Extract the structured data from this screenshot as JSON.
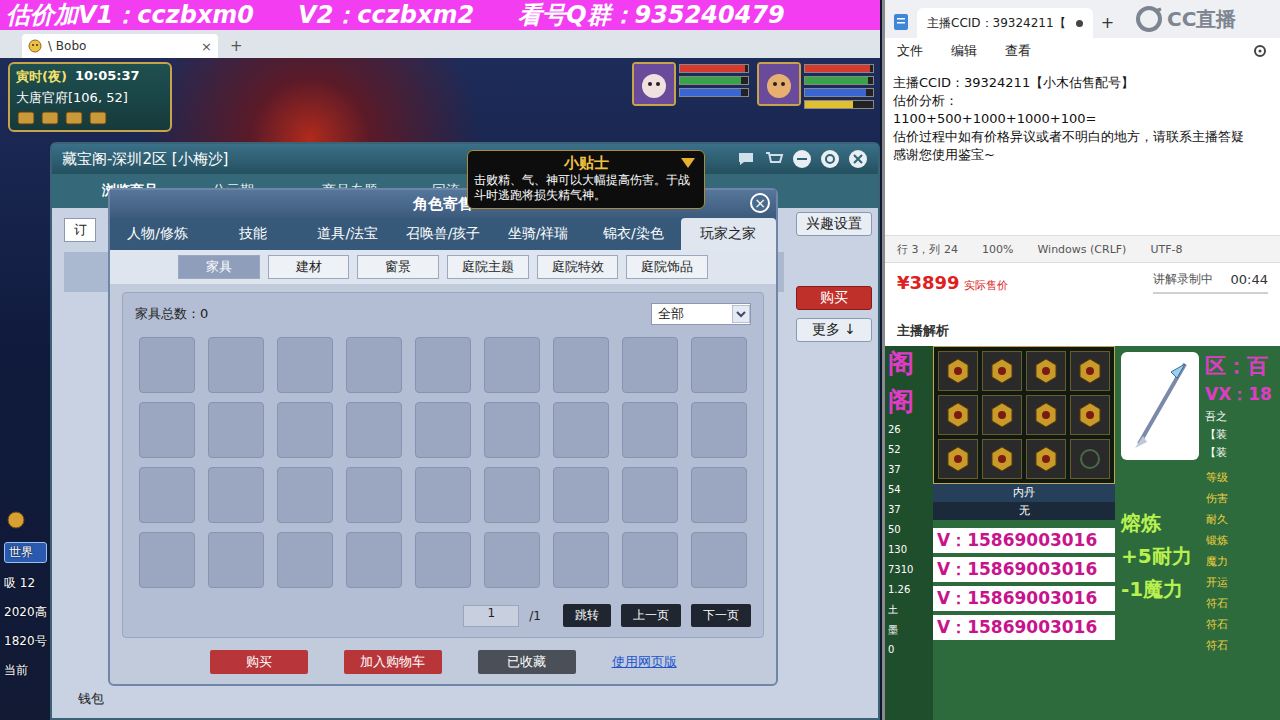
{
  "banner": {
    "items": [
      "估价加V1：cczbxm0",
      "V2：cczbxm2",
      "看号Q群：935240479"
    ]
  },
  "browser": {
    "tab": "\\ Bobo",
    "close": "×",
    "new_tab": "+"
  },
  "hud": {
    "period": "寅时(夜)",
    "time": "10:05:37",
    "location": "大唐官府[106, 52]"
  },
  "portraits": [
    {
      "bars": [
        {
          "level": 0.95,
          "color": "#d43a2f"
        },
        {
          "level": 0.9,
          "color": "#3aa34a"
        },
        {
          "level": 0.9,
          "color": "#3a66d4"
        }
      ]
    },
    {
      "bars": [
        {
          "level": 0.95,
          "color": "#d43a2f"
        },
        {
          "level": 0.92,
          "color": "#3aa34a"
        },
        {
          "level": 0.9,
          "color": "#3a66d4"
        },
        {
          "level": 0.7,
          "color": "#e0c030"
        }
      ]
    }
  ],
  "side": {
    "items": [
      "世界",
      "吸 12",
      "2020高",
      "1820号",
      "当前"
    ]
  },
  "cbg": {
    "title": "藏宝阁-深圳2区 [小梅沙]",
    "tabs": [
      {
        "label": "浏览商品",
        "selected": true
      },
      {
        "label": "公示期",
        "selected": false
      },
      {
        "label": "商品专题",
        "selected": false
      },
      {
        "label": "回流",
        "selected": false
      }
    ],
    "order_stub": "订",
    "side_buttons": [
      {
        "label": "兴趣设置",
        "kind": "plain"
      },
      {
        "label": "购买",
        "kind": "primary"
      },
      {
        "label": "更多 ↓",
        "kind": "plain"
      }
    ],
    "wallet": "钱包"
  },
  "dialog": {
    "title": "角色寄售",
    "close": "×",
    "tabs": [
      {
        "label": "人物/修炼",
        "selected": false
      },
      {
        "label": "技能",
        "selected": false
      },
      {
        "label": "道具/法宝",
        "selected": false
      },
      {
        "label": "召唤兽/孩子",
        "selected": false
      },
      {
        "label": "坐骑/祥瑞",
        "selected": false
      },
      {
        "label": "锦衣/染色",
        "selected": false
      },
      {
        "label": "玩家之家",
        "selected": true
      }
    ],
    "subtabs": [
      {
        "label": "家具",
        "selected": true
      },
      {
        "label": "建材",
        "selected": false
      },
      {
        "label": "窗景",
        "selected": false
      },
      {
        "label": "庭院主题",
        "selected": false
      },
      {
        "label": "庭院特效",
        "selected": false
      },
      {
        "label": "庭院饰品",
        "selected": false
      }
    ],
    "count_label": "家具总数：",
    "count": "0",
    "filter": "全部",
    "slots": [
      {
        "filled": false
      },
      {
        "filled": false
      },
      {
        "filled": false
      },
      {
        "filled": false
      },
      {
        "filled": false
      },
      {
        "filled": false
      },
      {
        "filled": false
      },
      {
        "filled": false
      },
      {
        "filled": false
      },
      {
        "filled": false
      },
      {
        "filled": false
      },
      {
        "filled": false
      },
      {
        "filled": false
      },
      {
        "filled": false
      },
      {
        "filled": false
      },
      {
        "filled": false
      },
      {
        "filled": false
      },
      {
        "filled": false
      },
      {
        "filled": false
      },
      {
        "filled": false
      },
      {
        "filled": false
      },
      {
        "filled": false
      },
      {
        "filled": false
      },
      {
        "filled": false
      },
      {
        "filled": false
      },
      {
        "filled": false
      },
      {
        "filled": false
      },
      {
        "filled": false
      },
      {
        "filled": false
      },
      {
        "filled": false
      },
      {
        "filled": false
      },
      {
        "filled": false
      },
      {
        "filled": false
      },
      {
        "filled": false
      },
      {
        "filled": false
      },
      {
        "filled": false
      }
    ],
    "pager": {
      "page": "1",
      "total": "/1"
    },
    "pager_buttons": [
      "跳转",
      "上一页",
      "下一页"
    ],
    "actions": [
      {
        "label": "购买",
        "kind": "primary"
      },
      {
        "label": "加入购物车",
        "kind": "primary"
      },
      {
        "label": "已收藏",
        "kind": "muted"
      }
    ],
    "web_link": "使用网页版"
  },
  "tip": {
    "title": "小贴士",
    "text": "击败精、气、神可以大幅提高伤害。于战斗时逃跑将损失精气神。"
  },
  "notepad": {
    "tab": "主播CCID：39324211【",
    "modified": true,
    "new_tab": "+",
    "menu": [
      "文件",
      "编辑",
      "查看"
    ],
    "lines": [
      "主播CCID：39324211【小木估售配号】",
      "估价分析：",
      "1100+500+1000+1000+100=",
      "估价过程中如有价格异议或者不明白的地方，请联系主播答疑",
      "感谢您使用鉴宝~"
    ],
    "status": [
      "行 3，列 24",
      "100%",
      "Windows (CRLF)",
      "UTF-8"
    ]
  },
  "logo": {
    "text": "CC直播"
  },
  "price": {
    "amount": "¥3899",
    "label": "实际售价",
    "recording": "讲解录制中",
    "timer": "00:44",
    "analysis": "主播解析"
  },
  "shot": {
    "marks": [
      "阁",
      "阁"
    ],
    "level": "26",
    "stats": [
      "52",
      "37",
      "54",
      "37",
      "50",
      "130",
      "7310",
      "1.26",
      "土",
      "墨",
      "0"
    ],
    "slots": [
      {
        "filled": true
      },
      {
        "filled": true
      },
      {
        "filled": true
      },
      {
        "filled": true
      },
      {
        "filled": true
      },
      {
        "filled": true
      },
      {
        "filled": true
      },
      {
        "filled": true
      },
      {
        "filled": true
      },
      {
        "filled": true
      },
      {
        "filled": true
      },
      {
        "filled": false
      }
    ],
    "neidan_label": "内丹",
    "neidan": "无",
    "contacts": [
      "V：15869003016",
      "V：15869003016",
      "V：15869003016",
      "V：15869003016"
    ],
    "region": "区：百",
    "vx": "VX：18",
    "item_lines": [
      "吾之",
      "【装",
      "【装"
    ],
    "smelt": {
      "title": "熔炼",
      "lines": [
        "+5耐力",
        "-1魔力"
      ]
    },
    "attrs": [
      "等级",
      "伤害",
      "耐久",
      "锻炼",
      "魔力",
      "开运",
      "符石",
      "符石",
      "符石"
    ]
  }
}
